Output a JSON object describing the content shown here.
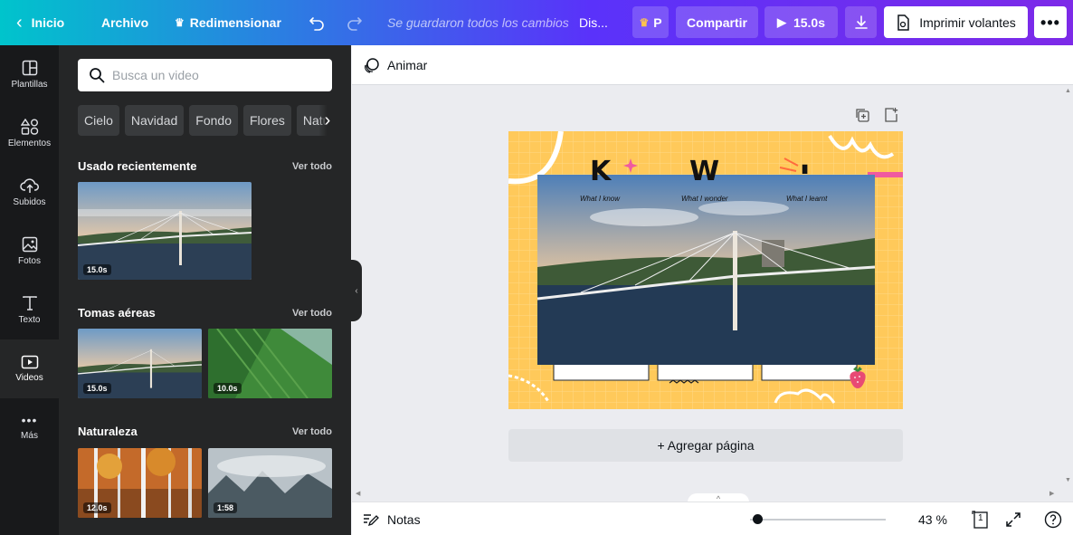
{
  "topbar": {
    "back_label": "Inicio",
    "file_label": "Archivo",
    "resize_label": "Redimensionar",
    "saved_status": "Se guardaron todos los cambios",
    "design_title": "Dis...",
    "pro_label": "P",
    "share_label": "Compartir",
    "play_label": "15.0s",
    "print_label": "Imprimir volantes",
    "colors": {
      "gradient_start": "#00c4cc",
      "gradient_end": "#7d2ae8",
      "crown": "#ffc44d"
    }
  },
  "rail": {
    "items": [
      {
        "label": "Plantillas",
        "icon": "templates-icon"
      },
      {
        "label": "Elementos",
        "icon": "elements-icon"
      },
      {
        "label": "Subidos",
        "icon": "upload-cloud-icon"
      },
      {
        "label": "Fotos",
        "icon": "photo-icon"
      },
      {
        "label": "Texto",
        "icon": "text-icon"
      },
      {
        "label": "Videos",
        "icon": "video-icon",
        "active": true
      },
      {
        "label": "Más",
        "icon": "more-dots-icon"
      }
    ]
  },
  "panel": {
    "search_placeholder": "Busca un video",
    "chips": [
      "Cielo",
      "Navidad",
      "Fondo",
      "Flores",
      "Natu"
    ],
    "sections": [
      {
        "title": "Usado recientemente",
        "link": "Ver todo",
        "durations": [
          "15.0s"
        ]
      },
      {
        "title": "Tomas aéreas",
        "link": "Ver todo",
        "durations": [
          "15.0s",
          "10.0s"
        ]
      },
      {
        "title": "Naturaleza",
        "link": "Ver todo",
        "durations": [
          "12.0s",
          "1:58"
        ]
      }
    ]
  },
  "toolbar": {
    "animate_label": "Animar"
  },
  "artboard": {
    "letters": [
      "K",
      "W",
      "L"
    ],
    "captions": [
      "What I know",
      "What I wonder",
      "What I learnt"
    ],
    "background": "#ffc95a"
  },
  "canvas": {
    "add_page_label": "+ Agregar página"
  },
  "bottombar": {
    "notes_label": "Notas",
    "zoom_value": 0.43,
    "zoom_label": "43 %",
    "page_count": "1"
  }
}
